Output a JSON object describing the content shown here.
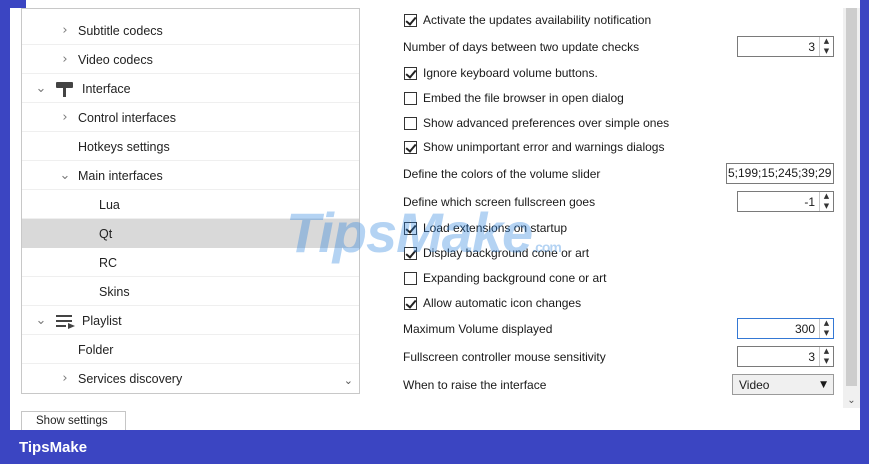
{
  "tree": {
    "items": [
      {
        "label": "Subtitle codecs",
        "arrow": "›"
      },
      {
        "label": "Video codecs",
        "arrow": "›"
      },
      {
        "label": "Interface",
        "arrow": "⌄"
      },
      {
        "label": "Control interfaces",
        "arrow": "›"
      },
      {
        "label": "Hotkeys settings",
        "arrow": ""
      },
      {
        "label": "Main interfaces",
        "arrow": "⌄"
      },
      {
        "label": "Lua",
        "arrow": ""
      },
      {
        "label": "Qt",
        "arrow": "",
        "selected": true
      },
      {
        "label": "RC",
        "arrow": ""
      },
      {
        "label": "Skins",
        "arrow": ""
      },
      {
        "label": "Playlist",
        "arrow": "⌄"
      },
      {
        "label": "Folder",
        "arrow": ""
      },
      {
        "label": "Services discovery",
        "arrow": "›"
      }
    ],
    "scroll_down": "⌄"
  },
  "settings": {
    "activate_updates": {
      "label": "Activate the updates availability notification",
      "checked": true
    },
    "update_days": {
      "label": "Number of days between two update checks",
      "value": "3"
    },
    "ignore_keyboard_volume": {
      "label": "Ignore keyboard volume buttons.",
      "checked": true
    },
    "embed_file_browser": {
      "label": "Embed the file browser in open dialog",
      "checked": false
    },
    "advanced_prefs": {
      "label": "Show advanced preferences over simple ones",
      "checked": false
    },
    "unimportant_errors": {
      "label": "Show unimportant error and warnings dialogs",
      "checked": true
    },
    "volume_colors": {
      "label": "Define the colors of the volume slider",
      "value": "5;199;15;245;39;29"
    },
    "fullscreen_screen": {
      "label": "Define which screen fullscreen goes",
      "value": "-1"
    },
    "load_extensions": {
      "label": "Load extensions on startup",
      "checked": true
    },
    "display_bg_cone": {
      "label": "Display background cone or art",
      "checked": true
    },
    "expanding_bg_cone": {
      "label": "Expanding background cone or art",
      "checked": false
    },
    "auto_icon_changes": {
      "label": "Allow automatic icon changes",
      "checked": true
    },
    "max_volume": {
      "label": "Maximum Volume displayed",
      "value": "300"
    },
    "mouse_sensitivity": {
      "label": "Fullscreen controller mouse sensitivity",
      "value": "3"
    },
    "raise_interface": {
      "label": "When to raise the interface",
      "value": "Video"
    }
  },
  "spin_up": "▲",
  "spin_down": "▼",
  "dropdown_caret": "▼",
  "scroll_down_arrow": "⌄",
  "bottom": {
    "show_settings": "Show settings"
  },
  "footer": {
    "brand": "TipsMake"
  },
  "watermark": {
    "text": "TipsMake",
    "suffix": ".com"
  },
  "colors": {
    "frame": "#3b45c2",
    "selected_row": "#d9d9d9",
    "focus": "#3478d4"
  }
}
